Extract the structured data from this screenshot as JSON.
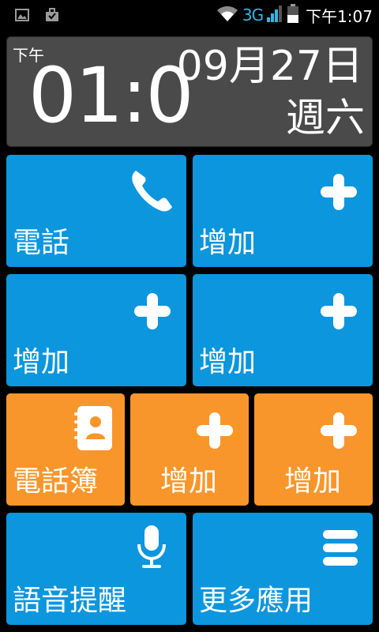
{
  "status_bar": {
    "left_icons": [
      "image-icon",
      "briefcase-icon"
    ],
    "network": "3G",
    "time": "下午1:07",
    "right_icons": [
      "wifi-icon",
      "signal-icon",
      "battery-icon"
    ]
  },
  "clock": {
    "ampm": "下午",
    "time": "01:0",
    "date": "09月27日",
    "weekday": "週六"
  },
  "tiles": [
    {
      "label": "電話",
      "icon": "phone-icon",
      "color": "#0b96dd"
    },
    {
      "label": "增加",
      "icon": "plus-icon",
      "color": "#0b96dd"
    },
    {
      "label": "增加",
      "icon": "plus-icon",
      "color": "#0b96dd"
    },
    {
      "label": "增加",
      "icon": "plus-icon",
      "color": "#0b96dd"
    },
    {
      "label": "電話簿",
      "icon": "contacts-book-icon",
      "color": "#f9962b"
    },
    {
      "label": "增加",
      "icon": "plus-icon",
      "color": "#f9962b"
    },
    {
      "label": "增加",
      "icon": "plus-icon",
      "color": "#f9962b"
    },
    {
      "label": "語音提醒",
      "icon": "microphone-icon",
      "color": "#0b96dd"
    },
    {
      "label": "更多應用",
      "icon": "menu-icon",
      "color": "#0b96dd"
    }
  ]
}
